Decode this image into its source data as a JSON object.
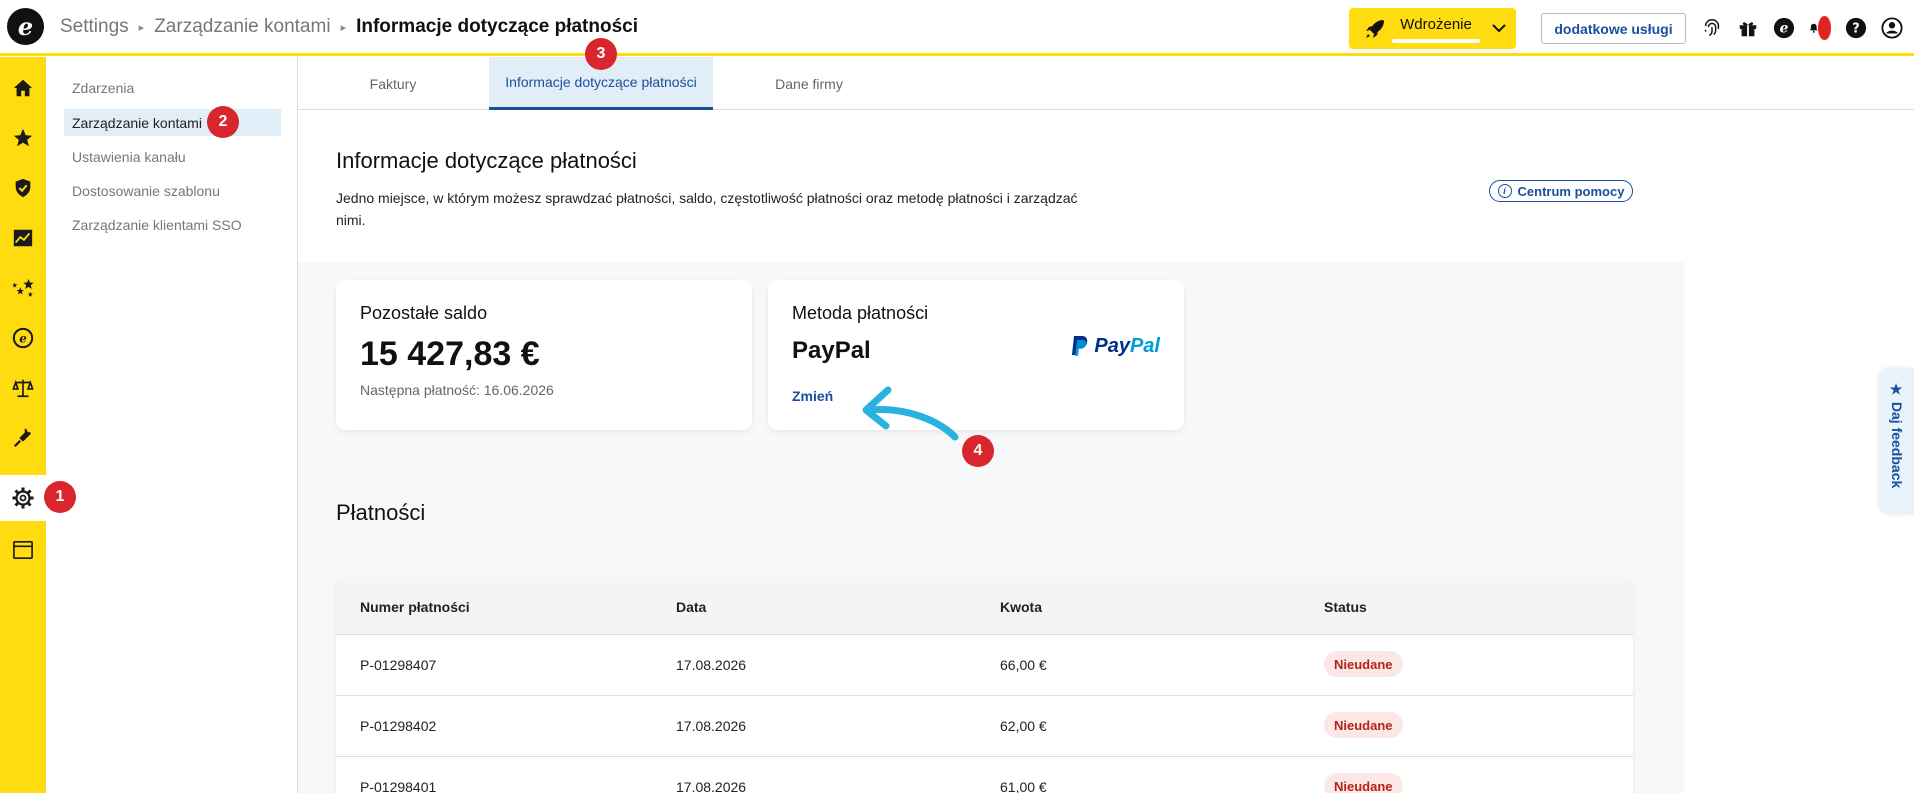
{
  "header": {
    "logo_letter": "e",
    "breadcrumb": [
      "Settings",
      "Zarządzanie kontami",
      "Informacje dotyczące płatności"
    ],
    "implementation_label": "Wdrożenie",
    "extra_services_label": "dodatkowe usługi",
    "icons": [
      "fingerprint-icon",
      "gift-icon",
      "e-logo-icon",
      "bell-icon",
      "help-icon",
      "user-icon"
    ]
  },
  "rail": {
    "icons": [
      "home-icon",
      "star-icon",
      "shield-icon",
      "chart-icon",
      "stars-icon",
      "e-coin-icon",
      "scale-icon",
      "plug-icon",
      "gear-icon",
      "window-icon"
    ],
    "active_index": 8
  },
  "subnav": {
    "items": [
      "Zdarzenia",
      "Zarządzanie kontami",
      "Ustawienia kanału",
      "Dostosowanie szablonu",
      "Zarządzanie klientami SSO"
    ],
    "active_index": 1
  },
  "tabs": [
    "Faktury",
    "Informacje dotyczące płatności",
    "Dane firmy"
  ],
  "page": {
    "title": "Informacje dotyczące płatności",
    "description": "Jedno miejsce, w którym możesz sprawdzać płatności, saldo, częstotliwość płatności oraz metodę płatności i zarządzać nimi.",
    "help_label": "Centrum pomocy"
  },
  "balance_card": {
    "title": "Pozostałe saldo",
    "amount": "15 427,83 €",
    "next_payment": "Następna płatność: 16.06.2026"
  },
  "method_card": {
    "title": "Metoda płatności",
    "method": "PayPal",
    "change_label": "Zmień",
    "logo_text_1": "Pay",
    "logo_text_2": "Pal"
  },
  "payments": {
    "title": "Płatności",
    "columns": [
      "Numer płatności",
      "Data",
      "Kwota",
      "Status"
    ],
    "rows": [
      {
        "id": "P-01298407",
        "date": "17.08.2026",
        "amount": "66,00 €",
        "status": "Nieudane"
      },
      {
        "id": "P-01298402",
        "date": "17.08.2026",
        "amount": "62,00 €",
        "status": "Nieudane"
      },
      {
        "id": "P-01298401",
        "date": "17.08.2026",
        "amount": "61,00 €",
        "status": "Nieudane"
      }
    ]
  },
  "badges": [
    "1",
    "2",
    "3",
    "4"
  ],
  "feedback_label": "★ Daj feedback",
  "colors": {
    "brand_yellow": "#FFDC0F",
    "accent_blue": "#1a4fa0",
    "badge_red": "#d9262e",
    "status_red": "#b42318"
  }
}
